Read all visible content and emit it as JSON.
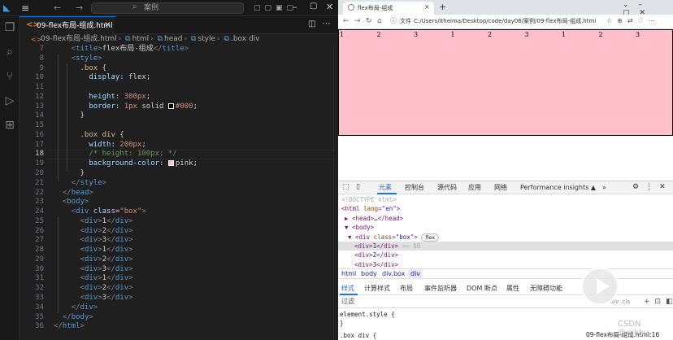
{
  "vscode": {
    "menu_icon": "≡",
    "search_placeholder": "案例",
    "tab": {
      "icon": "<>",
      "label": "09-flex布局-组成.html",
      "close": "×"
    },
    "breadcrumb": [
      "09-flex布局-组成.html",
      "html",
      "head",
      "style",
      ".box div"
    ],
    "current_line": 18,
    "lines": [
      {
        "n": 7,
        "tokens": [
          [
            "pu",
            "    <"
          ],
          [
            "t",
            "title"
          ],
          [
            "pu",
            ">"
          ],
          [
            "tx",
            "flex布局-组成"
          ],
          [
            "pu",
            "</"
          ],
          [
            "t",
            "title"
          ],
          [
            "pu",
            ">"
          ]
        ]
      },
      {
        "n": 8,
        "tokens": [
          [
            "pu",
            "    <"
          ],
          [
            "t",
            "style"
          ],
          [
            "pu",
            ">"
          ]
        ]
      },
      {
        "n": 9,
        "tokens": [
          [
            "se",
            "      .box"
          ],
          [
            "tx",
            " {"
          ]
        ]
      },
      {
        "n": 10,
        "tokens": [
          [
            "pr",
            "        display"
          ],
          [
            "tx",
            ": "
          ],
          [
            "tx",
            "flex"
          ],
          [
            "tx",
            ";"
          ]
        ]
      },
      {
        "n": 11,
        "tokens": []
      },
      {
        "n": 12,
        "tokens": [
          [
            "pr",
            "        height"
          ],
          [
            "tx",
            ": "
          ],
          [
            "va",
            "300px"
          ],
          [
            "tx",
            ";"
          ]
        ]
      },
      {
        "n": 13,
        "tokens": [
          [
            "pr",
            "        border"
          ],
          [
            "tx",
            ": "
          ],
          [
            "va",
            "1px"
          ],
          [
            "tx",
            " solid "
          ],
          [
            "sw",
            "#000000"
          ],
          [
            "va",
            "#000"
          ],
          [
            "tx",
            ";"
          ]
        ]
      },
      {
        "n": 14,
        "tokens": [
          [
            "tx",
            "      }"
          ]
        ]
      },
      {
        "n": 15,
        "tokens": []
      },
      {
        "n": 16,
        "tokens": [
          [
            "se",
            "      .box div"
          ],
          [
            "tx",
            " {"
          ]
        ]
      },
      {
        "n": 17,
        "tokens": [
          [
            "pr",
            "        width"
          ],
          [
            "tx",
            ": "
          ],
          [
            "va",
            "200px"
          ],
          [
            "tx",
            ";"
          ]
        ]
      },
      {
        "n": 18,
        "tokens": [
          [
            "cm",
            "        /* height: 100px; */"
          ]
        ]
      },
      {
        "n": 19,
        "tokens": [
          [
            "pr",
            "        background-color"
          ],
          [
            "tx",
            ": "
          ],
          [
            "sw",
            "#ffc0cb"
          ],
          [
            "tx",
            "pink;"
          ]
        ]
      },
      {
        "n": 20,
        "tokens": [
          [
            "tx",
            "      }"
          ]
        ]
      },
      {
        "n": 21,
        "tokens": [
          [
            "pu",
            "    </"
          ],
          [
            "t",
            "style"
          ],
          [
            "pu",
            ">"
          ]
        ]
      },
      {
        "n": 22,
        "tokens": [
          [
            "pu",
            "  </"
          ],
          [
            "t",
            "head"
          ],
          [
            "pu",
            ">"
          ]
        ]
      },
      {
        "n": 23,
        "tokens": [
          [
            "pu",
            "  <"
          ],
          [
            "t",
            "body"
          ],
          [
            "pu",
            ">"
          ]
        ]
      },
      {
        "n": 24,
        "tokens": [
          [
            "pu",
            "    <"
          ],
          [
            "t",
            "div"
          ],
          [
            "at",
            " class"
          ],
          [
            "tx",
            "="
          ],
          [
            "st",
            "\"box\""
          ],
          [
            "pu",
            ">"
          ]
        ]
      },
      {
        "n": 25,
        "tokens": [
          [
            "pu",
            "      <"
          ],
          [
            "t",
            "div"
          ],
          [
            "pu",
            ">"
          ],
          [
            "tx",
            "1"
          ],
          [
            "pu",
            "</"
          ],
          [
            "t",
            "div"
          ],
          [
            "pu",
            ">"
          ]
        ]
      },
      {
        "n": 26,
        "tokens": [
          [
            "pu",
            "      <"
          ],
          [
            "t",
            "div"
          ],
          [
            "pu",
            ">"
          ],
          [
            "tx",
            "2"
          ],
          [
            "pu",
            "</"
          ],
          [
            "t",
            "div"
          ],
          [
            "pu",
            ">"
          ]
        ]
      },
      {
        "n": 27,
        "tokens": [
          [
            "pu",
            "      <"
          ],
          [
            "t",
            "div"
          ],
          [
            "pu",
            ">"
          ],
          [
            "tx",
            "3"
          ],
          [
            "pu",
            "</"
          ],
          [
            "t",
            "div"
          ],
          [
            "pu",
            ">"
          ]
        ]
      },
      {
        "n": 28,
        "tokens": [
          [
            "pu",
            "      <"
          ],
          [
            "t",
            "div"
          ],
          [
            "pu",
            ">"
          ],
          [
            "tx",
            "1"
          ],
          [
            "pu",
            "</"
          ],
          [
            "t",
            "div"
          ],
          [
            "pu",
            ">"
          ]
        ]
      },
      {
        "n": 29,
        "tokens": [
          [
            "pu",
            "      <"
          ],
          [
            "t",
            "div"
          ],
          [
            "pu",
            ">"
          ],
          [
            "tx",
            "2"
          ],
          [
            "pu",
            "</"
          ],
          [
            "t",
            "div"
          ],
          [
            "pu",
            ">"
          ]
        ]
      },
      {
        "n": 30,
        "tokens": [
          [
            "pu",
            "      <"
          ],
          [
            "t",
            "div"
          ],
          [
            "pu",
            ">"
          ],
          [
            "tx",
            "3"
          ],
          [
            "pu",
            "</"
          ],
          [
            "t",
            "div"
          ],
          [
            "pu",
            ">"
          ]
        ]
      },
      {
        "n": 31,
        "tokens": [
          [
            "pu",
            "      <"
          ],
          [
            "t",
            "div"
          ],
          [
            "pu",
            ">"
          ],
          [
            "tx",
            "1"
          ],
          [
            "pu",
            "</"
          ],
          [
            "t",
            "div"
          ],
          [
            "pu",
            ">"
          ]
        ]
      },
      {
        "n": 32,
        "tokens": [
          [
            "pu",
            "      <"
          ],
          [
            "t",
            "div"
          ],
          [
            "pu",
            ">"
          ],
          [
            "tx",
            "2"
          ],
          [
            "pu",
            "</"
          ],
          [
            "t",
            "div"
          ],
          [
            "pu",
            ">"
          ]
        ]
      },
      {
        "n": 33,
        "tokens": [
          [
            "pu",
            "      <"
          ],
          [
            "t",
            "div"
          ],
          [
            "pu",
            ">"
          ],
          [
            "tx",
            "3"
          ],
          [
            "pu",
            "</"
          ],
          [
            "t",
            "div"
          ],
          [
            "pu",
            ">"
          ]
        ]
      },
      {
        "n": 34,
        "tokens": [
          [
            "pu",
            "    </"
          ],
          [
            "t",
            "div"
          ],
          [
            "pu",
            ">"
          ]
        ]
      },
      {
        "n": 35,
        "tokens": [
          [
            "pu",
            "  </"
          ],
          [
            "t",
            "body"
          ],
          [
            "pu",
            ">"
          ]
        ]
      },
      {
        "n": 36,
        "tokens": [
          [
            "pu",
            "</"
          ],
          [
            "t",
            "html"
          ],
          [
            "pu",
            ">"
          ]
        ]
      }
    ]
  },
  "browser": {
    "tab_title": "flex布局-组成",
    "tab_close": "×",
    "new_tab": "+",
    "url_label": "文件",
    "url": "C:/Users/itheima/Desktop/code/day06/案例/09-flex布局-组成.html",
    "box_items": [
      "1",
      "2",
      "3",
      "1",
      "2",
      "3",
      "1",
      "2",
      "3"
    ],
    "box_color": "#ffc0cb"
  },
  "devtools": {
    "tabs": [
      "元素",
      "控制台",
      "源代码",
      "应用",
      "网络",
      "Performance insights ▲",
      "»"
    ],
    "dom_lines": [
      {
        "indent": 1,
        "parts": [
          [
            "dcom",
            "<!DOCTYPE html>"
          ]
        ]
      },
      {
        "indent": 1,
        "parts": [
          [
            "dtag",
            "<html "
          ],
          [
            "dattr",
            "lang"
          ],
          [
            "dtag",
            "=\""
          ],
          [
            "dval",
            "en"
          ],
          [
            "dtag",
            "\">"
          ]
        ]
      },
      {
        "indent": 2,
        "parts": [
          [
            "dtag",
            "▶ <head>"
          ],
          [
            "dtxt",
            "…"
          ],
          [
            "dtag",
            "</head>"
          ]
        ]
      },
      {
        "indent": 2,
        "parts": [
          [
            "dtag",
            "▼ <body>"
          ]
        ]
      },
      {
        "indent": 3,
        "parts": [
          [
            "dtag",
            "▼ <div "
          ],
          [
            "dattr",
            "class"
          ],
          [
            "dtag",
            "=\""
          ],
          [
            "dval",
            "box"
          ],
          [
            "dtag",
            "\">"
          ]
        ]
      },
      {
        "indent": 5,
        "parts": [
          [
            "dtag",
            "<div>"
          ],
          [
            "dtxt",
            "1"
          ],
          [
            "dtag",
            "</div>"
          ],
          [
            "dcom",
            " == $0"
          ]
        ]
      },
      {
        "indent": 5,
        "parts": [
          [
            "dtag",
            "<div>"
          ],
          [
            "dtxt",
            "2"
          ],
          [
            "dtag",
            "</div>"
          ]
        ]
      },
      {
        "indent": 5,
        "parts": [
          [
            "dtag",
            "<div>"
          ],
          [
            "dtxt",
            "3"
          ],
          [
            "dtag",
            "</div>"
          ]
        ]
      }
    ],
    "flex_badge": "flex",
    "crumbs": [
      "html",
      "body",
      "div.box",
      "div"
    ],
    "subtabs": [
      "样式",
      "计算样式",
      "布局",
      "事件监听器",
      "DOM 断点",
      "属性",
      "无障碍功能"
    ],
    "filter_label": "过滤",
    "filter_hint": ":hov .cls",
    "styles_lines": [
      "element.style {",
      "}",
      ".box div {"
    ],
    "status_file": "09-flex布局-组成.html:16"
  },
  "watermark": "CSDN @xrkhy"
}
